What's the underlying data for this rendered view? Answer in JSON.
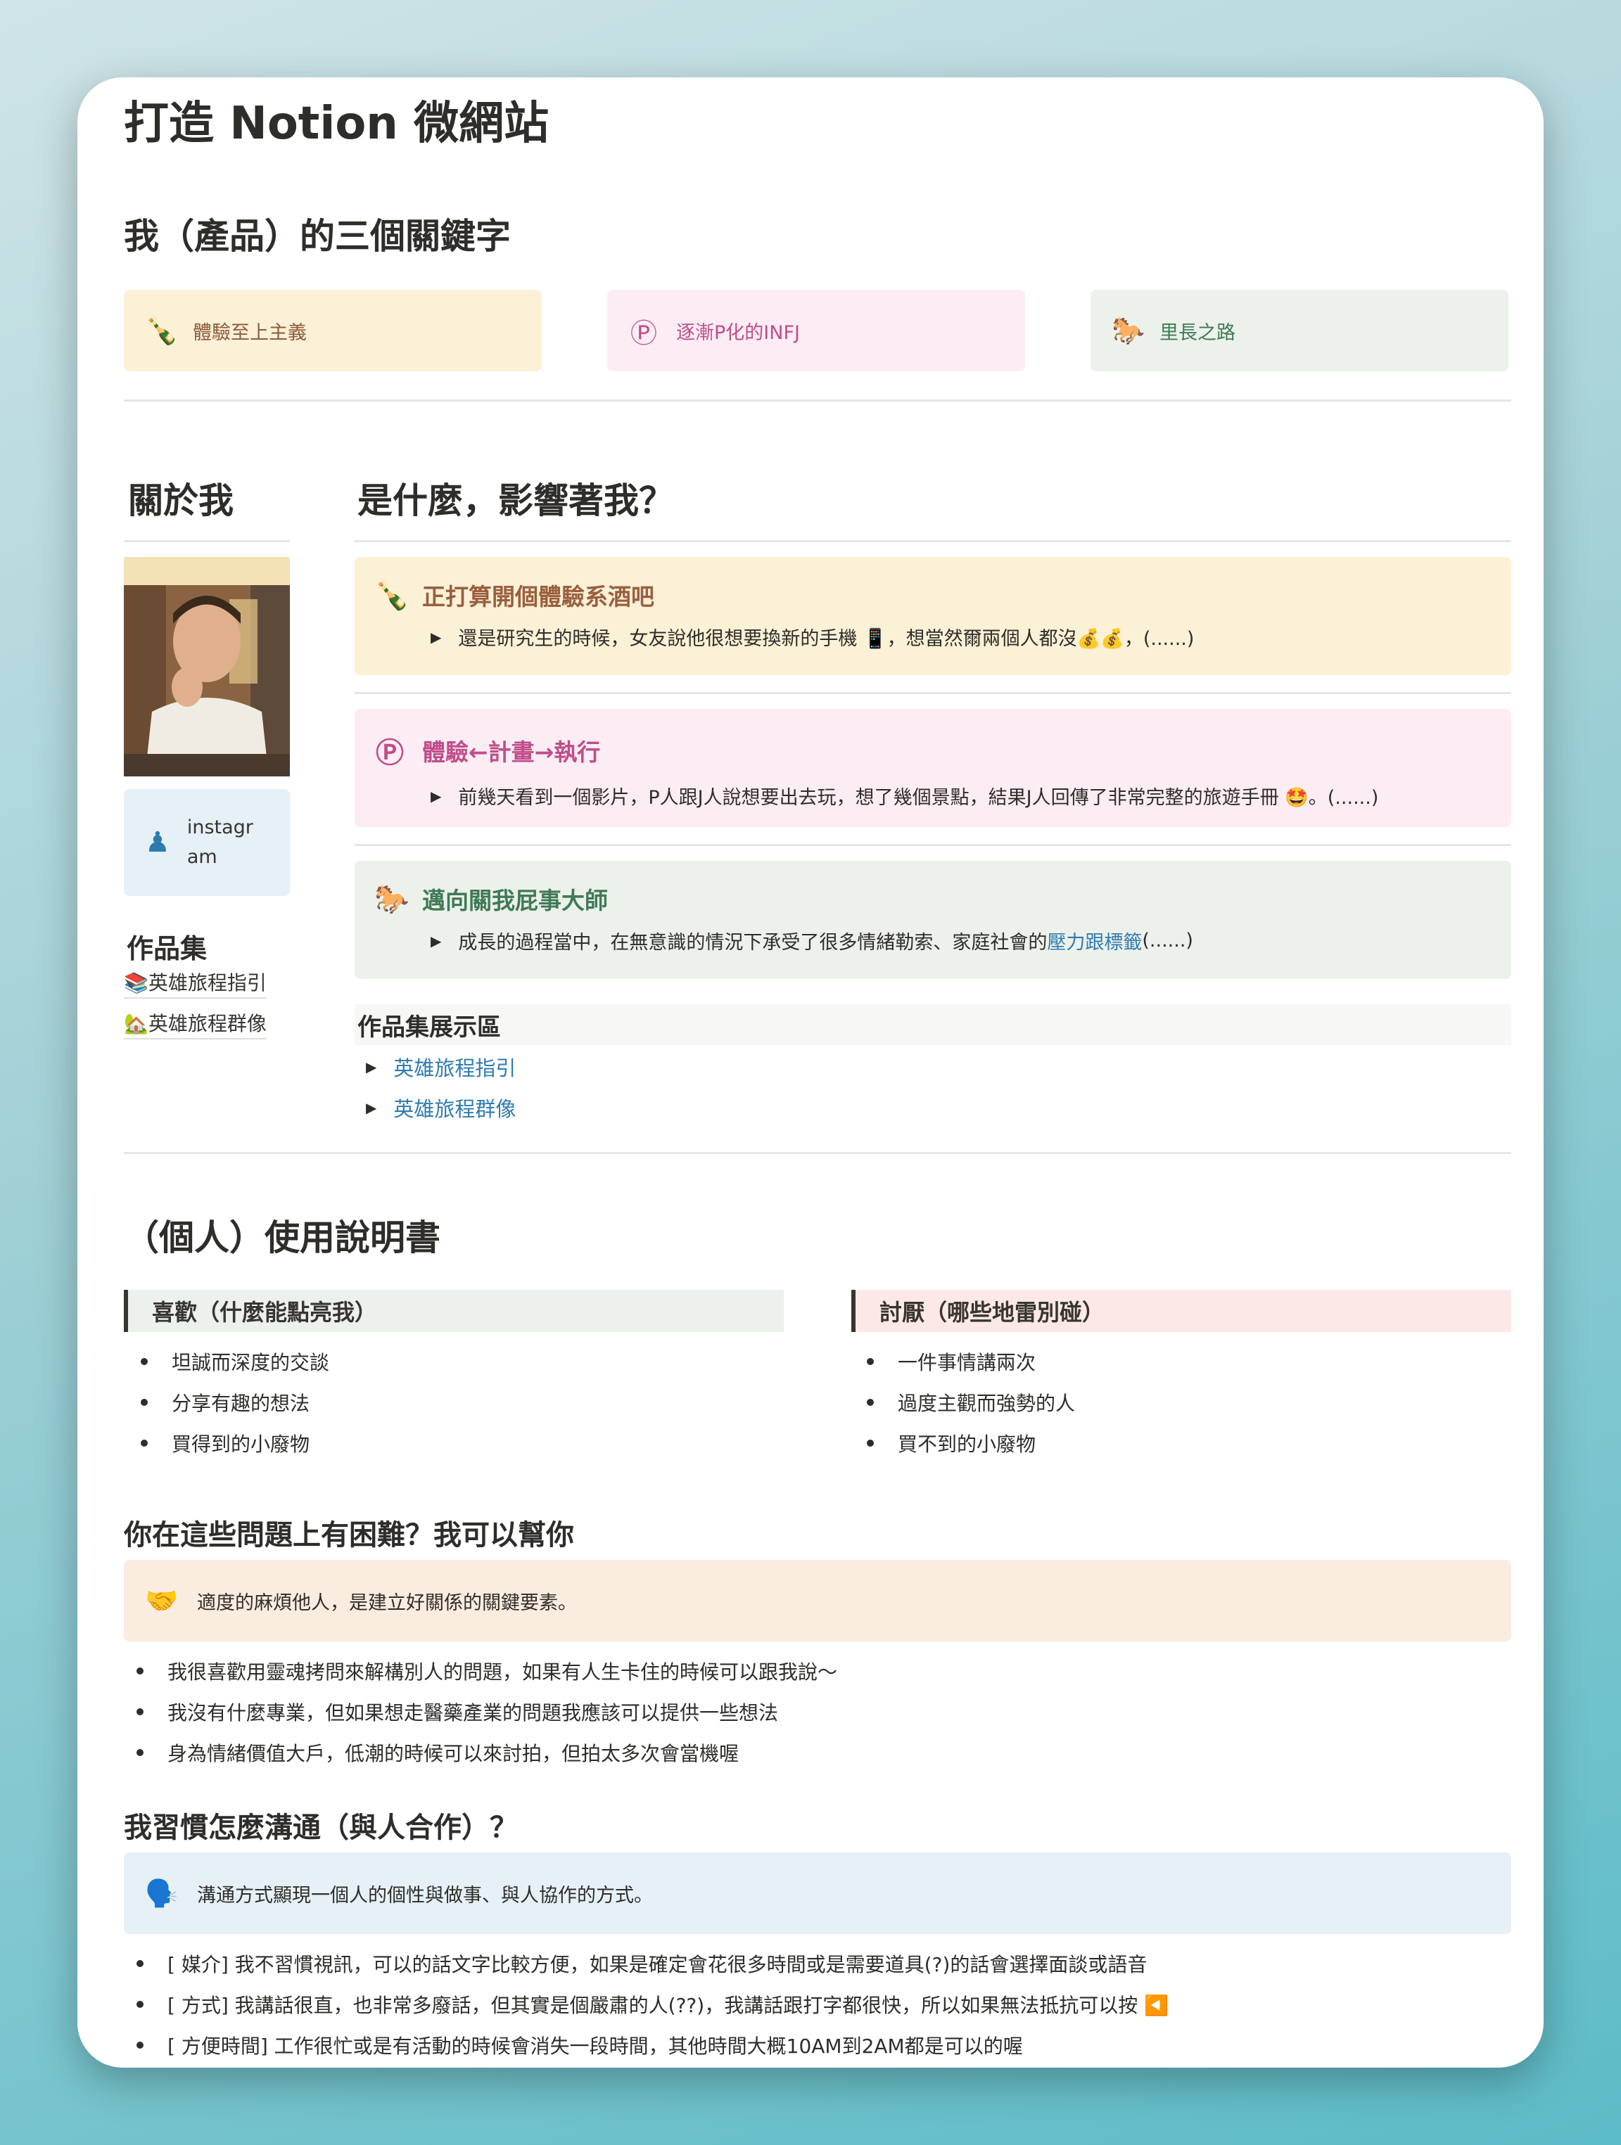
{
  "page": {
    "title": "打造 Notion 微網站"
  },
  "keywords": {
    "heading": "我（產品）的三個關鍵字",
    "items": [
      {
        "icon": "🍾",
        "label": "體驗至上主義"
      },
      {
        "icon": "Ⓟ",
        "label": "逐漸P化的INFJ"
      },
      {
        "icon": "🐎",
        "label": "里長之路"
      }
    ]
  },
  "about": {
    "heading": "關於我",
    "instagram_label": "instagram",
    "portfolio_heading": "作品集",
    "portfolio_links": [
      "📚英雄旅程指引",
      "🏡英雄旅程群像"
    ]
  },
  "influences": {
    "heading": "是什麼，影響著我？",
    "items": [
      {
        "icon": "🍾",
        "title": "正打算開個體驗系酒吧",
        "text": "還是研究生的時候，女友說他很想要換新的手機 📱，想當然爾兩個人都沒💰💰，(......)",
        "link": ""
      },
      {
        "icon": "Ⓟ",
        "title": "體驗←計畫→執行",
        "text": "前幾天看到一個影片，P人跟J人說想要出去玩，想了幾個景點，結果J人回傳了非常完整的旅遊手冊 🤩。(......)",
        "link": ""
      },
      {
        "icon": "🐎",
        "title": "邁向關我屁事大師",
        "text": "成長的過程當中，在無意識的情況下承受了很多情緒勒索、家庭社會的",
        "link": "壓力跟標籤",
        "tail": "(......)"
      }
    ]
  },
  "showcase": {
    "heading": "作品集展示區",
    "items": [
      "英雄旅程指引",
      "英雄旅程群像"
    ]
  },
  "manual": {
    "heading": "（個人）使用說明書",
    "likes_heading": "喜歡（什麼能點亮我）",
    "likes": [
      "坦誠而深度的交談",
      "分享有趣的想法",
      "買得到的小廢物"
    ],
    "dislikes_heading": "討厭（哪些地雷別碰）",
    "dislikes": [
      "一件事情講兩次",
      "過度主觀而強勢的人",
      "買不到的小廢物"
    ]
  },
  "help": {
    "heading": "你在這些問題上有困難？我可以幫你",
    "callout_icon": "🤝",
    "callout": "適度的麻煩他人，是建立好關係的關鍵要素。",
    "items": [
      "我很喜歡用靈魂拷問來解構別人的問題，如果有人生卡住的時候可以跟我說～",
      "我沒有什麼專業，但如果想走醫藥產業的問題我應該可以提供一些想法",
      "身為情緒價值大戶，低潮的時候可以來討拍，但拍太多次會當機喔"
    ]
  },
  "communicate": {
    "heading": "我習慣怎麼溝通（與人合作）？",
    "callout_icon": "🗣️",
    "callout": "溝通方式顯現一個人的個性與做事、與人協作的方式。",
    "items": [
      "[ 媒介] 我不習慣視訊，可以的話文字比較方便，如果是確定會花很多時間或是需要道具(?)的話會選擇面談或語音",
      "[ 方式] 我講話很直，也非常多廢話，但其實是個嚴肅的人(??)，我講話跟打字都很快，所以如果無法抵抗可以按 ◀️",
      "[ 方便時間] 工作很忙或是有活動的時候會消失一段時間，其他時間大概10AM到2AM都是可以的喔"
    ]
  },
  "colors": {
    "yellow_bg": "#faf1d7",
    "pink_bg": "#fcedf4",
    "green_bg": "#ecf1eb",
    "orange_bg": "#fbece0",
    "blue_bg": "#e6f0f7",
    "red_bg": "#fde8e8",
    "link": "#2f7bb0"
  }
}
